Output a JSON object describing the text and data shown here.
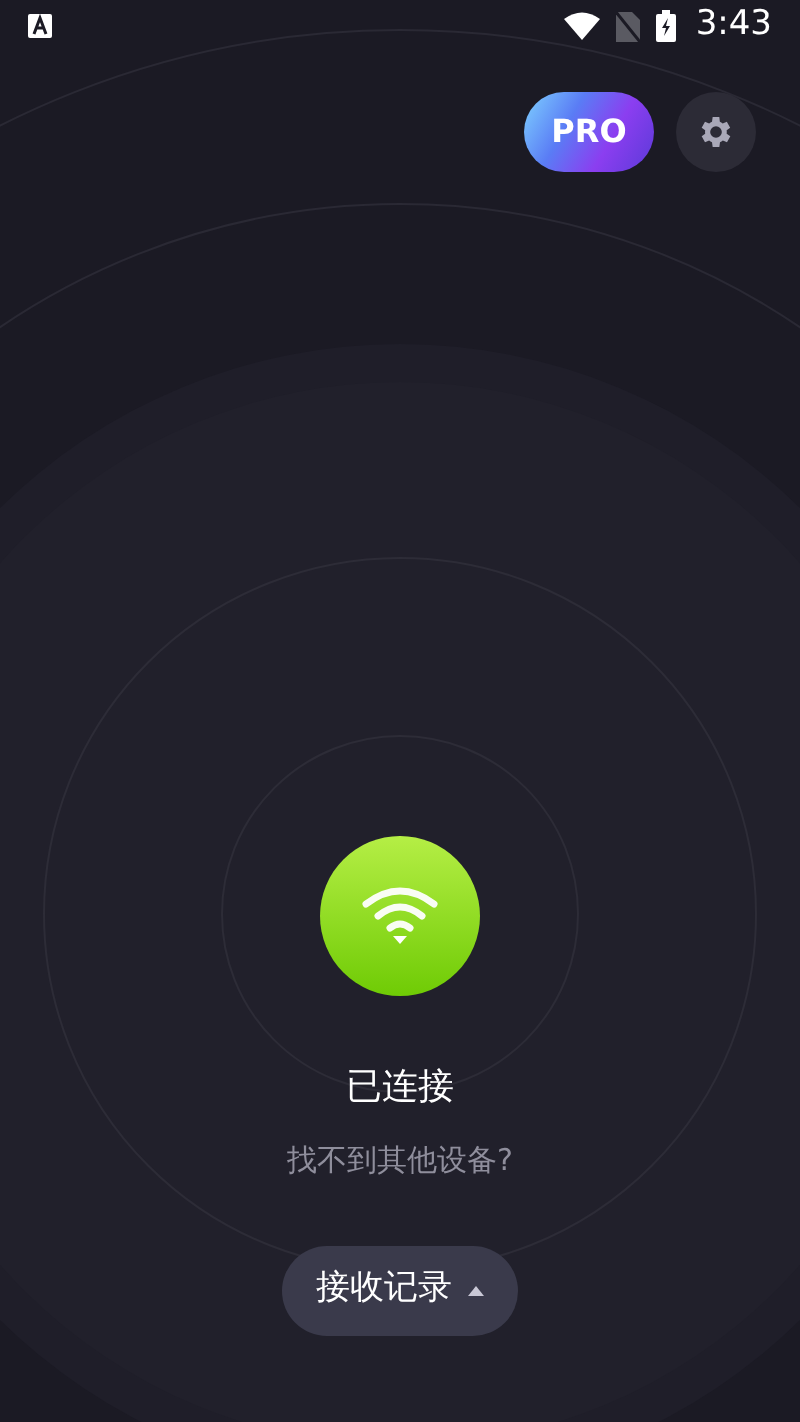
{
  "status_bar": {
    "time": "3:43"
  },
  "header": {
    "pro_badge": "PRO"
  },
  "connection": {
    "connected": true,
    "status": "已连接",
    "help_link": "找不到其他设备?"
  },
  "records_button": {
    "label": "接收记录",
    "expanded": false
  }
}
